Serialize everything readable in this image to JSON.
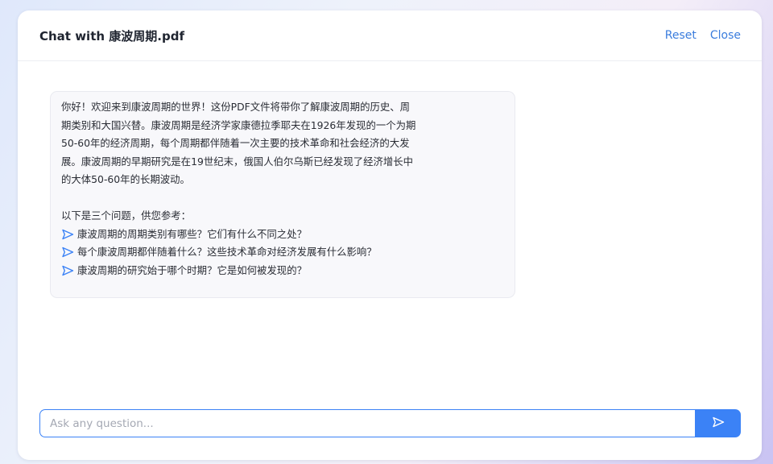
{
  "header": {
    "title": "Chat with 康波周期.pdf",
    "reset_label": "Reset",
    "close_label": "Close"
  },
  "message": {
    "intro": "你好！欢迎来到康波周期的世界！这份PDF文件将带你了解康波周期的历史、周\n期类别和大国兴替。康波周期是经济学家康德拉季耶夫在1926年发现的一个为期\n50-60年的经济周期，每个周期都伴随着一次主要的技术革命和社会经济的大发\n展。康波周期的早期研究是在19世纪末，俄国人伯尔乌斯已经发现了经济增长中\n的大体50-60年的长期波动。",
    "questions_heading": "以下是三个问题，供您参考：",
    "suggestions": [
      "康波周期的周期类别有哪些？它们有什么不同之处？",
      "每个康波周期都伴随着什么？这些技术革命对经济发展有什么影响？",
      "康波周期的研究始于哪个时期？它是如何被发现的？"
    ]
  },
  "composer": {
    "placeholder": "Ask any question...",
    "value": ""
  },
  "icons": {
    "suggestion": "send-arrow-icon",
    "send": "send-arrow-icon"
  },
  "colors": {
    "accent": "#3b82f6",
    "link": "#3b7ddd"
  }
}
